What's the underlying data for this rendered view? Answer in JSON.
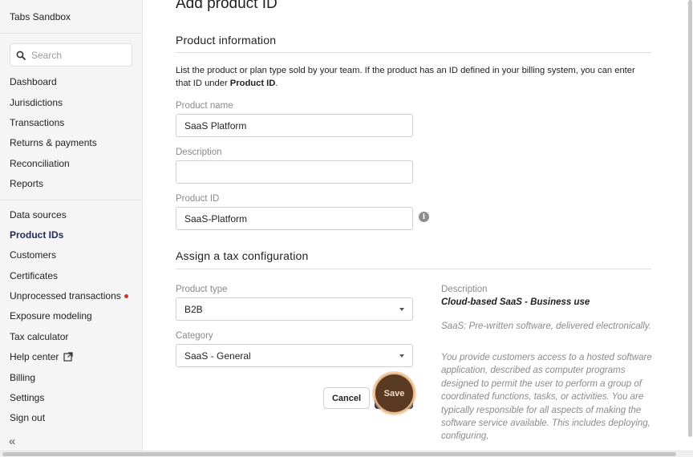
{
  "sidebar": {
    "org_name": "Tabs Sandbox",
    "search_placeholder": "Search",
    "items_top": [
      "Dashboard",
      "Jurisdictions",
      "Transactions",
      "Returns & payments",
      "Reconciliation",
      "Reports"
    ],
    "items_bottom": [
      "Data sources",
      "Product IDs",
      "Customers",
      "Certificates",
      "Unprocessed transactions",
      "Exposure modeling",
      "Tax calculator",
      "Help center",
      "Billing",
      "Settings",
      "Sign out"
    ],
    "active_item": "Product IDs",
    "collapse_symbol": "«"
  },
  "page": {
    "title": "Add product ID"
  },
  "product_info": {
    "heading": "Product information",
    "intro_text": "List the product or plan type sold by your team. If the product has an ID defined in your billing system, you can enter that ID under ",
    "intro_bold": "Product ID",
    "intro_end": ".",
    "name_label": "Product name",
    "name_value": "SaaS Platform",
    "description_label": "Description",
    "description_value": "",
    "id_label": "Product ID",
    "id_value": "SaaS-Platform"
  },
  "tax_config": {
    "heading": "Assign a tax configuration",
    "type_label": "Product type",
    "type_value": "B2B",
    "category_label": "Category",
    "category_value": "SaaS - General",
    "desc_label": "Description",
    "desc_title": "Cloud-based SaaS - Business use",
    "desc_p1": "SaaS: Pre-written software, delivered electronically.",
    "desc_p2": "You provide customers access to a hosted software application, described as computer programs designed to permit the user to perform a group of coordinated functions, tasks, or activities. You are typically responsible for all aspects of making the software service available. This includes deploying, configuring,"
  },
  "actions": {
    "cancel_label": "Cancel",
    "save_label": "Save"
  },
  "colors": {
    "accent": "#1e2a55",
    "alert_dot": "#d93025",
    "highlight_ring": "#e9b887"
  }
}
